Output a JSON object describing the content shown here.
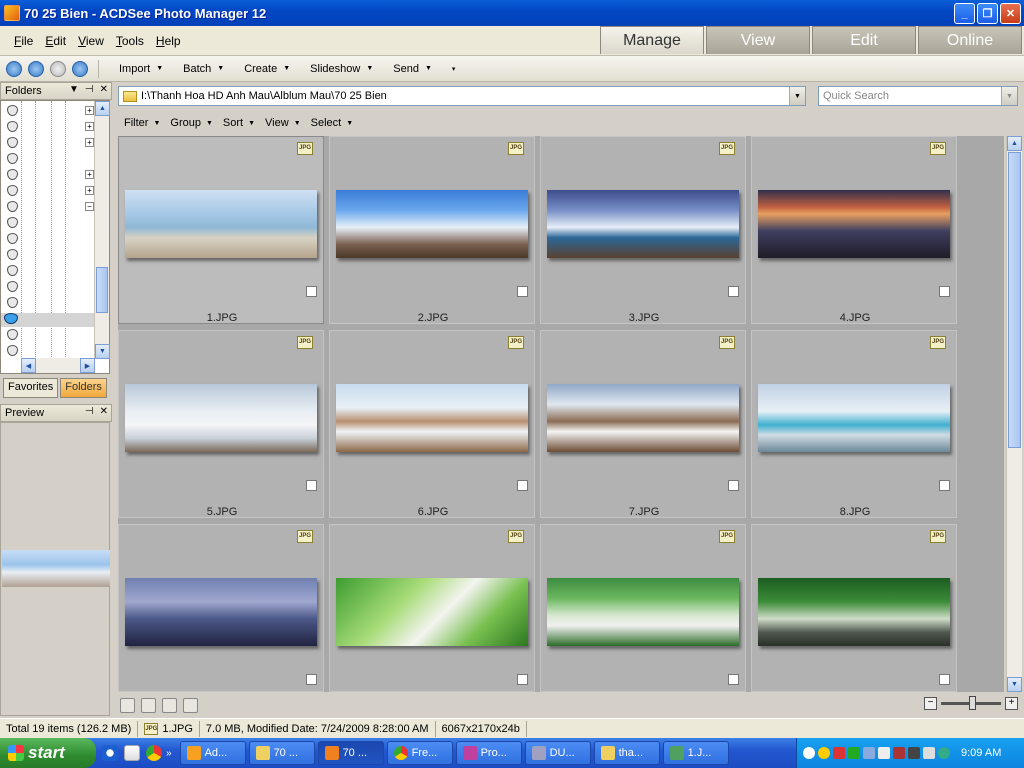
{
  "window": {
    "title": "70 25 Bien - ACDSee Photo Manager 12"
  },
  "menu": [
    "File",
    "Edit",
    "View",
    "Tools",
    "Help"
  ],
  "mode_tabs": [
    {
      "label": "Manage",
      "active": true
    },
    {
      "label": "View",
      "active": false
    },
    {
      "label": "Edit",
      "active": false
    },
    {
      "label": "Online",
      "active": false
    }
  ],
  "toolbar": [
    "Import",
    "Batch",
    "Create",
    "Slideshow",
    "Send"
  ],
  "left": {
    "folders_title": "Folders",
    "favorites_tab": "Favorites",
    "folders_tab": "Folders",
    "preview_title": "Preview"
  },
  "path": "I:\\Thanh Hoa HD Anh Mau\\Alblum Mau\\70 25 Bien",
  "search_placeholder": "Quick Search",
  "filterbar": [
    "Filter",
    "Group",
    "Sort",
    "View",
    "Select"
  ],
  "thumbnails": [
    {
      "name": "1.JPG",
      "badge": "JPG"
    },
    {
      "name": "2.JPG",
      "badge": "JPG"
    },
    {
      "name": "3.JPG",
      "badge": "JPG"
    },
    {
      "name": "4.JPG",
      "badge": "JPG"
    },
    {
      "name": "5.JPG",
      "badge": "JPG"
    },
    {
      "name": "6.JPG",
      "badge": "JPG"
    },
    {
      "name": "7.JPG",
      "badge": "JPG"
    },
    {
      "name": "8.JPG",
      "badge": "JPG"
    },
    {
      "name": "",
      "badge": "JPG"
    },
    {
      "name": "",
      "badge": "JPG"
    },
    {
      "name": "",
      "badge": "JPG"
    },
    {
      "name": "",
      "badge": "JPG"
    }
  ],
  "status": {
    "total": "Total 19 items  (126.2 MB)",
    "file": "1.JPG",
    "info": "7.0 MB, Modified Date: 7/24/2009 8:28:00 AM",
    "dims": "6067x2170x24b"
  },
  "taskbar": {
    "start": "start",
    "tasks": [
      "Ad...",
      "70 ...",
      "70 ...",
      "Fre...",
      "Pro...",
      "DU...",
      "tha...",
      "1.J..."
    ],
    "clock": "9:09 AM"
  },
  "colors": {
    "title_blue": "#0347c4",
    "active_tab": "#f0a838",
    "taskbar": "#2458d0",
    "tray": "#0c84e0"
  }
}
